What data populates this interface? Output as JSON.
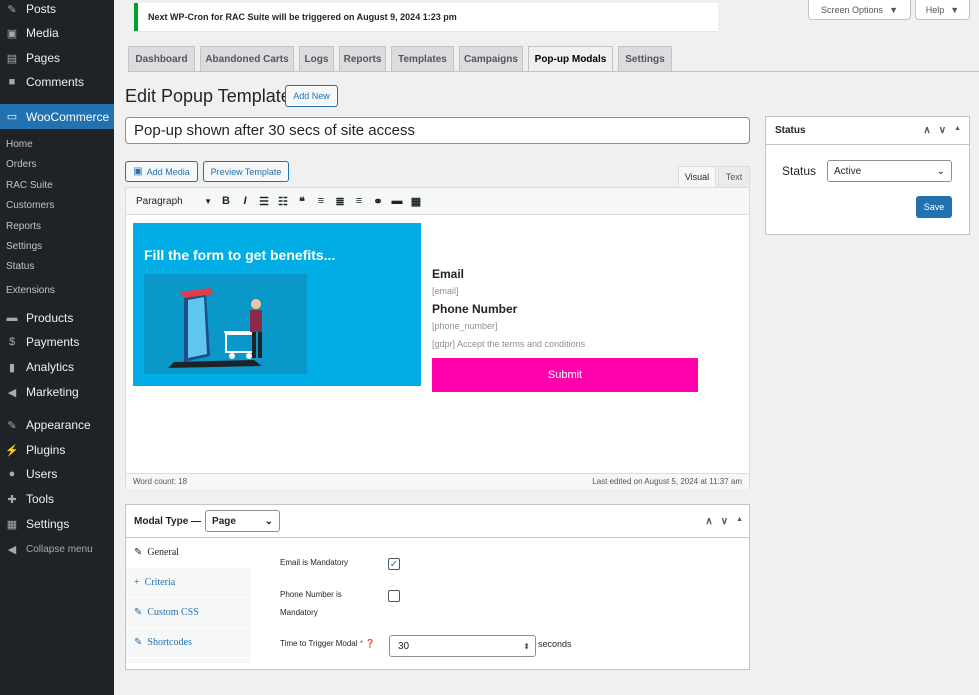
{
  "sidebar": {
    "posts": "Posts",
    "media": "Media",
    "pages": "Pages",
    "comments": "Comments",
    "woocommerce": "WooCommerce",
    "woo_sub": [
      "Home",
      "Orders",
      "RAC Suite",
      "Customers",
      "Reports",
      "Settings",
      "Status"
    ],
    "extensions": "Extensions",
    "products": "Products",
    "payments": "Payments",
    "analytics": "Analytics",
    "marketing": "Marketing",
    "appearance": "Appearance",
    "plugins": "Plugins",
    "users": "Users",
    "tools": "Tools",
    "settings": "Settings",
    "collapse": "Collapse menu"
  },
  "notice": "Next WP-Cron for RAC Suite will be triggered on August 9, 2024 1:23 pm",
  "screen_options": "Screen Options",
  "help": "Help",
  "tabs": [
    "Dashboard",
    "Abandoned Carts",
    "Logs",
    "Reports",
    "Templates",
    "Campaigns",
    "Pop-up Modals",
    "Settings"
  ],
  "page_title": "Edit Popup Template",
  "add_new": "Add New",
  "template_title": "Pop-up shown after 30 secs of site access",
  "add_media": "Add Media",
  "preview_template": "Preview Template",
  "editor_tabs": {
    "visual": "Visual",
    "text": "Text"
  },
  "format_select": "Paragraph",
  "popup": {
    "heading": "Fill the form to get benefits...",
    "email_label": "Email",
    "email_placeholder": "[email]",
    "phone_label": "Phone Number",
    "phone_placeholder": "[phone_number]",
    "gdpr": "[gdpr] Accept the terms and conditions",
    "submit": "Submit"
  },
  "word_count": "Word count: 18",
  "last_edited": "Last edited on August 5, 2024 at 11:37 am",
  "modal_type": {
    "label": "Modal Type —",
    "value": "Page",
    "nav": [
      "General",
      "Criteria",
      "Custom CSS",
      "Shortcodes"
    ],
    "email_mandatory": "Email is Mandatory",
    "email_mandatory_checked": true,
    "phone_mandatory_line1": "Phone Number is",
    "phone_mandatory_line2": "Mandatory",
    "phone_mandatory_checked": false,
    "time_label": "Time to Trigger Modal",
    "time_value": "30",
    "seconds": "seconds"
  },
  "status_box": {
    "title": "Status",
    "label": "Status",
    "value": "Active",
    "save": "Save"
  },
  "colors": {
    "accent": "#2271b1",
    "submit": "#ff00aa",
    "popup_bg": "#00aee5",
    "notice": "#00a32a"
  }
}
